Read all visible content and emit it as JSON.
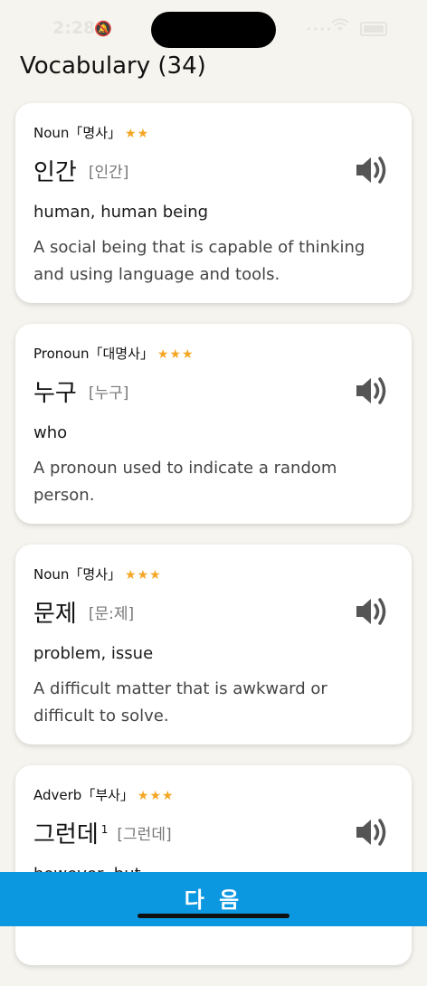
{
  "status": {
    "time": "2:28",
    "notification_icon": "bell-icon",
    "signal": "••••"
  },
  "title": "Vocabulary (34)",
  "words": [
    {
      "pos": "Noun「명사」",
      "stars": "★★",
      "word": "인간",
      "superscript": "",
      "pronunciation": "[인간]",
      "meaning": "human, human being",
      "definition": "A social being that is capable of thinking and using language and tools."
    },
    {
      "pos": "Pronoun「대명사」",
      "stars": "★★★",
      "word": "누구",
      "superscript": "",
      "pronunciation": "[누구]",
      "meaning": "who",
      "definition": "A pronoun used to indicate a random person."
    },
    {
      "pos": "Noun「명사」",
      "stars": "★★★",
      "word": "문제",
      "superscript": "",
      "pronunciation": "[문:제]",
      "meaning": "problem, issue",
      "definition": "A difficult matter that is awkward or difficult to solve."
    },
    {
      "pos": "Adverb「부사」",
      "stars": "★★★",
      "word": "그런데",
      "superscript": "1",
      "pronunciation": "[그런데]",
      "meaning": "however, but",
      "definition": ""
    }
  ],
  "next_button": "다 음",
  "colors": {
    "accent": "#0c98e0",
    "star": "#f5a623",
    "background": "#f6f4ee"
  }
}
